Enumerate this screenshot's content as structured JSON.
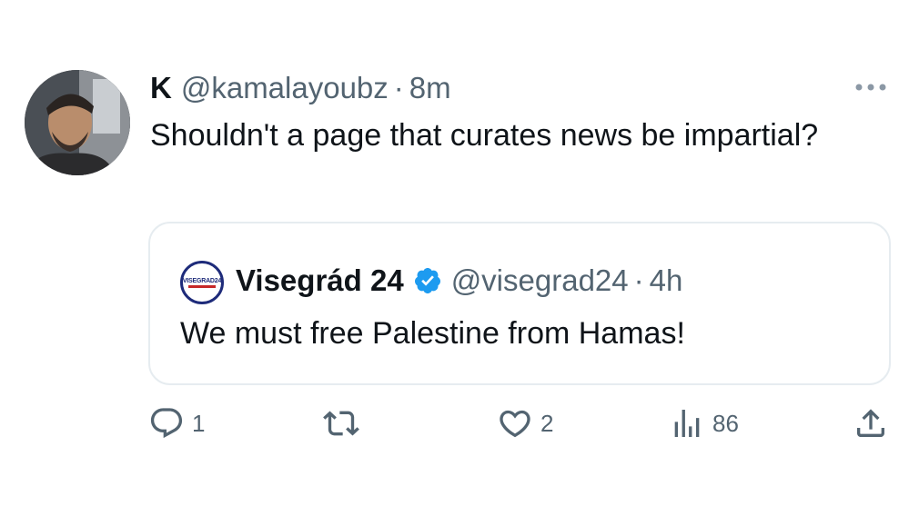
{
  "tweet": {
    "display_name": "K",
    "handle": "@kamalayoubz",
    "separator": "·",
    "time": "8m",
    "text": "Shouldn't a page that curates news be impartial?",
    "avatar_icon": "user-avatar-photo"
  },
  "quote": {
    "logo_text": "VISEGRAD24",
    "name": "Visegrád 24",
    "verified": true,
    "verified_color": "#1d9bf0",
    "handle": "@visegrad24",
    "separator": "·",
    "time": "4h",
    "text": "We must free Palestine from Hamas!"
  },
  "actions": {
    "reply": {
      "icon": "reply-icon",
      "count": "1"
    },
    "retweet": {
      "icon": "retweet-icon",
      "count": ""
    },
    "like": {
      "icon": "heart-icon",
      "count": "2"
    },
    "views": {
      "icon": "views-icon",
      "count": "86"
    },
    "share": {
      "icon": "share-icon"
    }
  },
  "colors": {
    "text": "#0f1419",
    "muted": "#536471",
    "border": "#e6ecf0",
    "accent": "#1d9bf0"
  }
}
